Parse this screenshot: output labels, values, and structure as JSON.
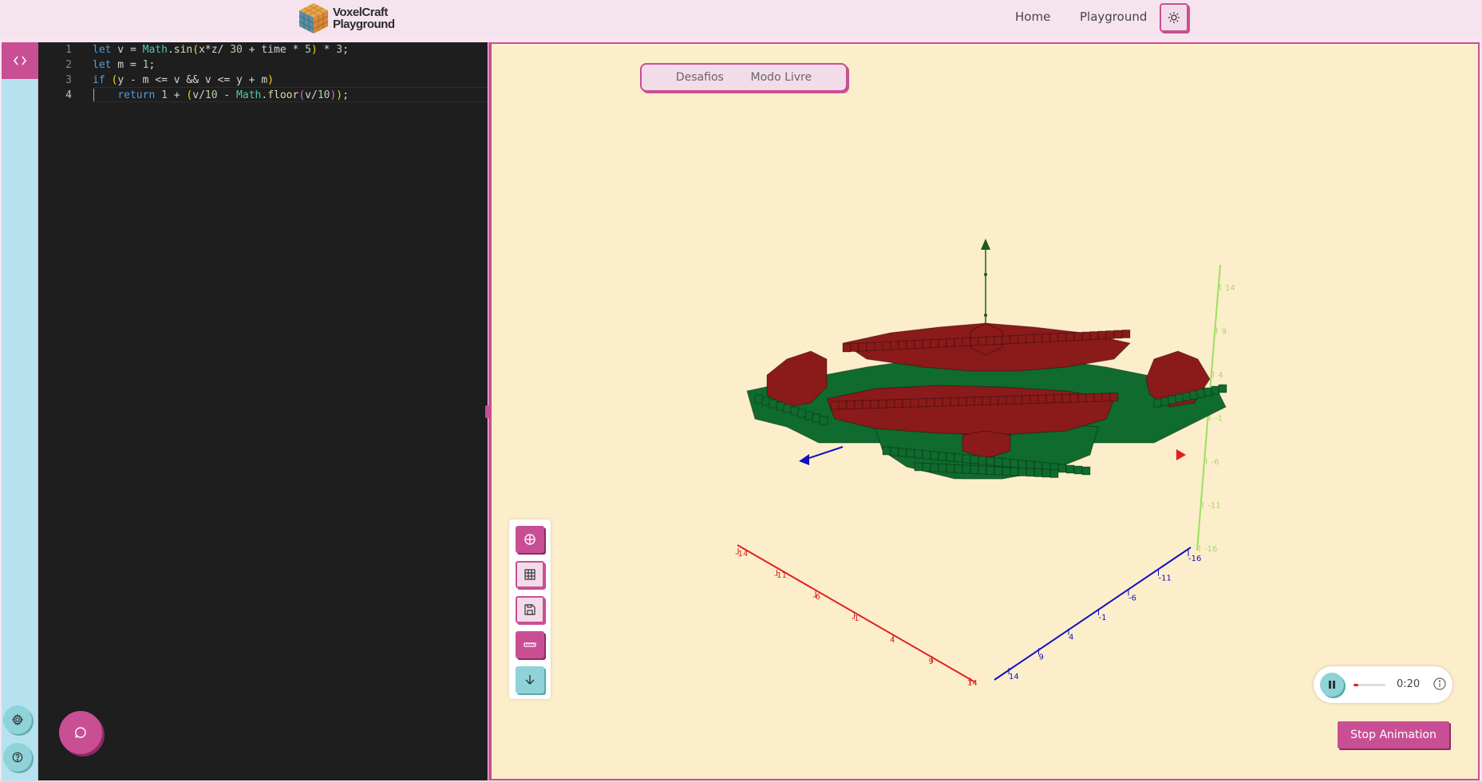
{
  "header": {
    "logo_line1": "VoxelCraft",
    "logo_line2": "Playground",
    "nav": {
      "home": "Home",
      "playground": "Playground"
    },
    "theme_icon": "sun-icon"
  },
  "sidebar": {
    "code_toggle_icon": "code-brackets-icon",
    "settings_icon": "gear-icon",
    "help_icon": "question-circle-icon",
    "chat_icon": "chat-bubble-icon"
  },
  "editor": {
    "line_numbers": [
      "1",
      "2",
      "3",
      "4"
    ],
    "active_line": 4
  },
  "viewport": {
    "tabs": {
      "challenges": "Desafios",
      "free_mode": "Modo Livre"
    },
    "toolbar_icons": [
      "crosshair-icon",
      "grid-icon",
      "save-icon",
      "ruler-icon",
      "arrow-down-icon"
    ],
    "colors": {
      "voxel_red": "#8b1a1a",
      "voxel_green": "#0f6b2e",
      "x_axis": "#e02020",
      "z_axis": "#1010c0",
      "y_axis": "#9ae060"
    },
    "axis_x_ticks": [
      "-14",
      "-11",
      "-6",
      "-1",
      "4",
      "9",
      "14"
    ],
    "axis_z_ticks": [
      "14",
      "9",
      "4",
      "-1",
      "-6",
      "-11",
      "-16"
    ],
    "axis_y_ticks": [
      "14",
      "9",
      "4",
      "-1",
      "-6",
      "-11",
      "-16"
    ]
  },
  "player": {
    "time": "0:20",
    "progress": 0.15,
    "pause_icon": "pause-icon",
    "info_icon": "info-icon"
  },
  "actions": {
    "stop": "Stop Animation"
  }
}
